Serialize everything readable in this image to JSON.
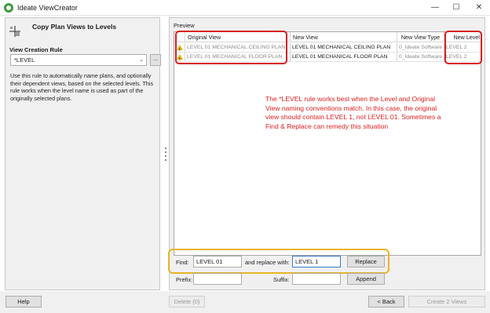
{
  "window": {
    "title": "Ideate ViewCreator"
  },
  "left": {
    "header": "Copy Plan Views to Levels",
    "rule_label": "View Creation Rule",
    "rule_value": "*LEVEL",
    "ellipsis": "...",
    "description": "Use this rule to automatically name plans, and optionally their dependent views, based on the selected levels. This rule works when the level name is used as part of the originally selected plans."
  },
  "preview": {
    "label": "Preview",
    "columns": [
      "Original View",
      "New View",
      "New View Type",
      "New Level"
    ],
    "rows": [
      {
        "original": "LEVEL 01 MECHANICAL CEILING PLAN",
        "new_view": "LEVEL 01 MECHANICAL CEILING PLAN",
        "type": "0_Ideate Software",
        "level": "LEVEL 2"
      },
      {
        "original": "LEVEL 01 MECHANICAL FLOOR PLAN",
        "new_view": "LEVEL 01 MECHANICAL FLOOR PLAN",
        "type": "0_Ideate Software",
        "level": "LEVEL 2"
      }
    ],
    "annotation": "The *LEVEL rule works best when the Level and Original View naming conventions match. In this case, the original view should contain LEVEL 1, not LEVEL 01. Sometimes a Find & Replace can remedy this situation"
  },
  "find": {
    "label": "Find:",
    "value": "LEVEL 01",
    "replace_label": "and replace with:",
    "replace_value": "LEVEL 1",
    "button": "Replace"
  },
  "prefix": {
    "label": "Prefix:",
    "value": "",
    "suffix_label": "Suffix:",
    "suffix_value": "",
    "button": "Append"
  },
  "buttons": {
    "help": "Help",
    "delete": "Delete (0)",
    "back": "< Back",
    "create": "Create 2 Views"
  },
  "colors": {
    "annotation": "#e02020",
    "highlight_red": "#d81e1e",
    "highlight_yellow": "#e6b42a",
    "warning": "#e8b400"
  },
  "icons": {
    "app": "ideate-logo-icon",
    "header": "plan-view-crosshair-icon",
    "warning": "warning-triangle-icon"
  }
}
